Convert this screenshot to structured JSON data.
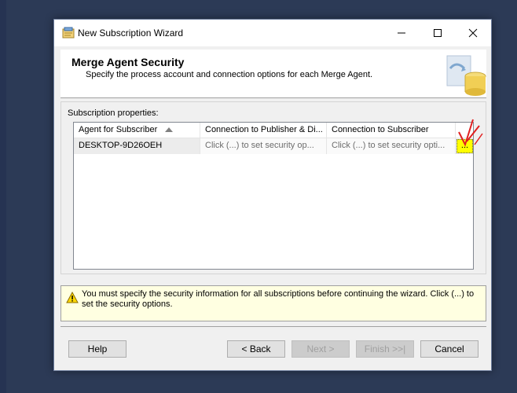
{
  "window": {
    "title": "New Subscription Wizard",
    "icon": "wizard-icon"
  },
  "header": {
    "title": "Merge Agent Security",
    "subtitle": "Specify the process account and connection options for each Merge Agent."
  },
  "subscription_properties": {
    "label": "Subscription properties:",
    "columns": [
      "Agent for Subscriber",
      "Connection to Publisher & Di...",
      "Connection to Subscriber"
    ],
    "rows": [
      {
        "agent": "DESKTOP-9D26OEH",
        "publisher_conn": "Click (...) to set security op...",
        "subscriber_conn": "Click (...) to set security opti...",
        "button": "..."
      }
    ]
  },
  "warning": {
    "text": "You must specify the security information for all subscriptions before continuing the wizard. Click (...) to set the security options."
  },
  "buttons": {
    "help": "Help",
    "back": "< Back",
    "next": "Next >",
    "finish": "Finish >>|",
    "cancel": "Cancel"
  },
  "colors": {
    "highlight": "#ffff00",
    "annotation": "#e02020"
  }
}
